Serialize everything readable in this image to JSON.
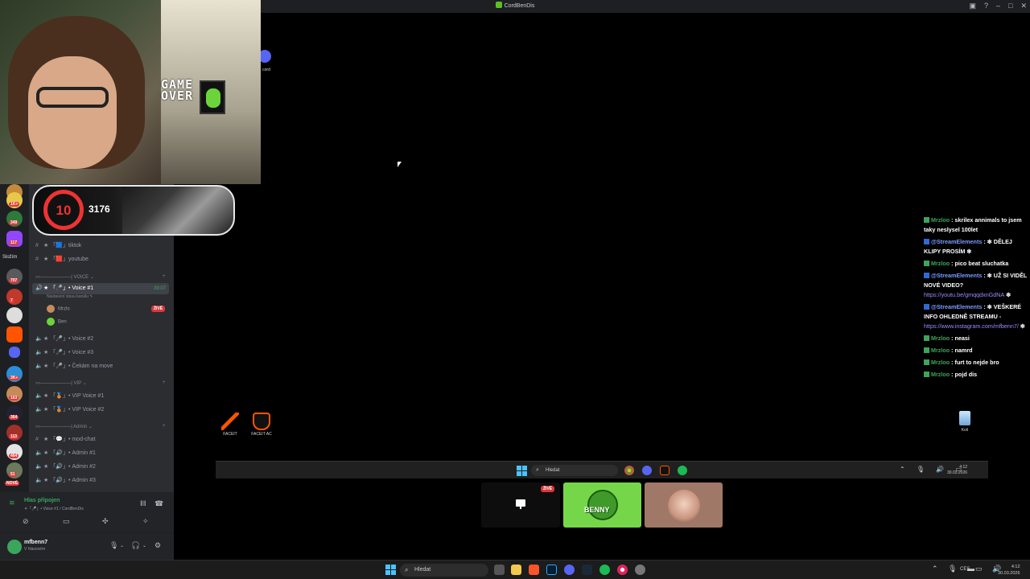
{
  "window": {
    "title": "CordBenDis"
  },
  "webcam": {
    "overlay_text": "GAME OVER"
  },
  "faceit_card": {
    "level": "10",
    "elo": "3176"
  },
  "servers": [
    {
      "badge": "1K+"
    },
    {
      "badge": "349"
    },
    {
      "badge": "117"
    },
    {
      "label": "Složím"
    },
    {
      "badge": "707"
    },
    {
      "badge": "7"
    },
    {
      "badge": ""
    },
    {
      "badge": ""
    },
    {
      "badge": ""
    },
    {
      "badge": "3K+"
    },
    {
      "badge": "163"
    },
    {
      "badge": "364"
    },
    {
      "badge": "113"
    },
    {
      "badge": "464"
    },
    {
      "badge": "51"
    },
    {
      "badge": "NOVÉ"
    }
  ],
  "channels": {
    "tiktok": "「🟦」tiktok",
    "youtube": "「🟥」youtube",
    "cat_voice": "›››─────────| VOICE ⌄",
    "voice1": "「🎤」• Voice #1",
    "voice1_time": "39:07",
    "voice1_status": "Nastavení stavu kanálu ✎",
    "member1": "Mrzlo",
    "member1_badge": "ŽIVĚ",
    "member2": "Ben",
    "voice2": "「🎤」• Voice #2",
    "voice3": "「🎤」• Voice #3",
    "cekam": "「🎤」• Čekám na move",
    "cat_vip": "›››─────────| VIP ⌄",
    "vip1": "「🥉」• VIP Voice #1",
    "vip2": "「🥉」• VIP Voice #2",
    "cat_admin": "›››─────────| Admin ⌄",
    "modchat": "「💬」• mod-chat",
    "admin1": "「🔊」• Admin #1",
    "admin2": "「🔊」• Admin #2",
    "admin3": "「🔊」• Admin #3"
  },
  "voice_status": {
    "title": "Hlas připojen",
    "subtitle": "✶「🎤」• Voice #1 / CordBenDis"
  },
  "user": {
    "name": "mfbenn7",
    "status": "V hlasovém"
  },
  "desktop_icons": {
    "faceit": "FACEIT",
    "faceit_ac": "FACEIT AC",
    "discord": "cord",
    "bin": "Koš"
  },
  "inner_taskbar": {
    "search": "Hledat",
    "time": "4:12",
    "date": "30.03.2026"
  },
  "stream_tiles": {
    "live": "ŽIVĚ",
    "benny": "BENNY"
  },
  "chat": [
    {
      "user": "Mrzloo",
      "text": "skrilex annimals to jsem taky neslysel 100let"
    },
    {
      "user": "@StreamElements",
      "text": "❇ DĚLEJ KLIPY PROSÍM ❇"
    },
    {
      "user": "Mrzloo",
      "text": "pico beat sluchatka"
    },
    {
      "user": "@StreamElements",
      "text": "❇ UŽ SI VIDĚL NOVÉ VIDEO?",
      "link": "https://youtu.be/gmqqdxnGdNA",
      "after": "❇"
    },
    {
      "user": "@StreamElements",
      "text": "❇ VEŠKERÉ INFO OHLEDNĚ STREAMU -",
      "link": "https://www.instagram.com/mfbenn7/",
      "after": "❇"
    },
    {
      "user": "Mrzloo",
      "text": "neasi"
    },
    {
      "user": "Mrzloo",
      "text": "namrd"
    },
    {
      "user": "Mrzloo",
      "text": "furt to nejde bro"
    },
    {
      "user": "Mrzloo",
      "text": "pojd dis"
    }
  ],
  "taskbar": {
    "search": "Hledat",
    "lang": "CES",
    "time": "4:12",
    "date": "30.03.2026"
  },
  "colors": {
    "discord_bg": "#2b2d31",
    "voice_green": "#3ba55c",
    "live_red": "#da373c",
    "faceit_red": "#e33333"
  }
}
